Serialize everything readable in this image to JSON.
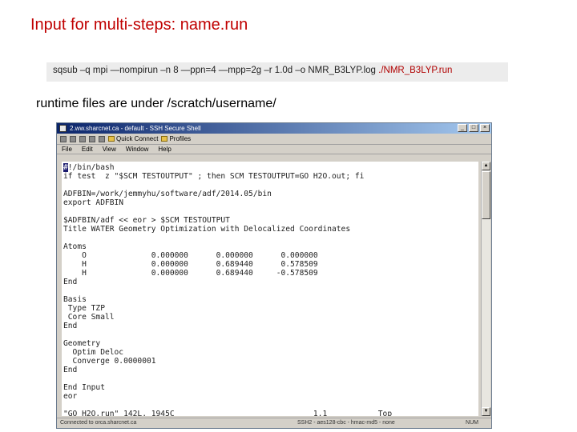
{
  "slide": {
    "title": "Input for multi-steps: name.run",
    "command_prefix": "sqsub –q mpi —nompirun –n 8 —ppn=4 —mpp=2g –r 1.0d –o NMR_B3LYP.log ",
    "command_highlight": "./NMR_B3LYP.run",
    "note": "runtime files are under /scratch/username/"
  },
  "window": {
    "title": "2.ww.sharcnet.ca - default - SSH Secure Shell",
    "menu": [
      "File",
      "Edit",
      "View",
      "Window",
      "Help"
    ],
    "toolbar": {
      "quick_connect": "Quick Connect",
      "profiles": "Profiles"
    },
    "status_left": "Connected to orca.sharcnet.ca",
    "status_mid": "SSH2 - aes128-cbc - hmac-md5 - none",
    "status_num": "NUM"
  },
  "terminal": {
    "lines": [
      "#!/bin/bash",
      "if test  z \"$SCM TESTOUTPUT\" ; then SCM TESTOUTPUT=GO H2O.out; fi",
      "",
      "ADFBIN=/work/jemmyhu/software/adf/2014.05/bin",
      "export ADFBIN",
      "",
      "$ADFBIN/adf << eor > $SCM TESTOUTPUT",
      "Title WATER Geometry Optimization with Delocalized Coordinates",
      "",
      "Atoms",
      "    O              0.000000      0.000000      0.000000",
      "    H              0.000000      0.689440      0.578509",
      "    H              0.000000      0.689440     -0.578509",
      "End",
      "",
      "Basis",
      " Type TZP",
      " Core Small",
      "End",
      "",
      "Geometry",
      "  Optim Deloc",
      "  Converge 0.0000001",
      "End",
      "",
      "End Input",
      "eor",
      "",
      "\"GO_H2O.run\" 142L, 1945C                              1,1           Top"
    ]
  }
}
